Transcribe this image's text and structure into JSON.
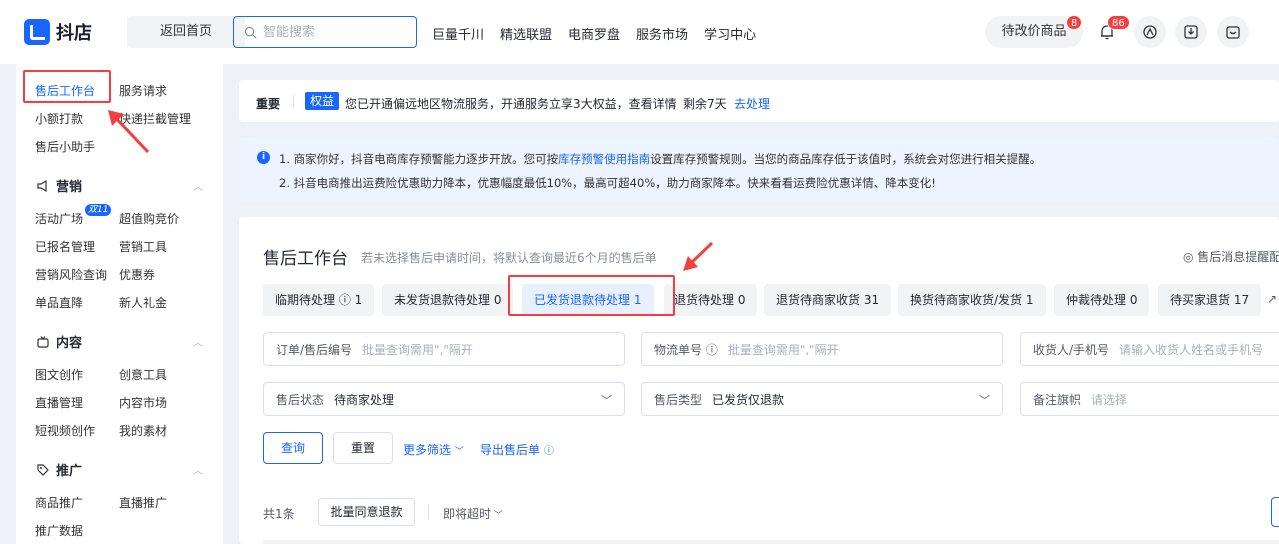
{
  "header": {
    "logo_text": "抖店",
    "home_label": "返回首页",
    "search_placeholder": "智能搜索",
    "nav": [
      "巨量千川",
      "精选联盟",
      "电商罗盘",
      "服务市场",
      "学习中心"
    ],
    "pending_label": "待改价商品",
    "pending_count": "8",
    "notify_count": "86"
  },
  "sidebar": {
    "top_items": [
      "售后工作台",
      "服务请求",
      "小额打款",
      "快递拦截管理",
      "售后小助手"
    ],
    "sections": [
      {
        "title": "营销",
        "items": [
          "活动广场",
          "超值购竞价",
          "已报名管理",
          "营销工具",
          "营销风险查询",
          "优惠券",
          "单品直降",
          "新人礼金"
        ],
        "tag": "双11"
      },
      {
        "title": "内容",
        "items": [
          "图文创作",
          "创意工具",
          "直播管理",
          "内容市场",
          "短视频创作",
          "我的素材"
        ]
      },
      {
        "title": "推广",
        "items": [
          "商品推广",
          "直播推广",
          "推广数据"
        ]
      }
    ]
  },
  "notice": {
    "label": "重要",
    "tag": "权益",
    "text": "您已开通偏远地区物流服务，开通服务立享3大权益，查看详情",
    "remain": "剩余7天",
    "action": "去处理"
  },
  "info": {
    "line1_pre": "1. 商家你好，抖音电商库存预警能力逐步开放。您可按",
    "line1_link": "库存预警使用指南",
    "line1_post": "设置库存预警规则。当您的商品库存低于该值时，系统会对您进行相关提醒。",
    "line2": "2. 抖音电商推出运费险优惠助力降本，优惠幅度最低10%，最高可超40%，助力商家降本。快来看看运费险优惠详情、降本变化!"
  },
  "workbench": {
    "title": "售后工作台",
    "subtitle": "若未选择售后申请时间，将默认查询最近6个月的售后单",
    "reminder": "售后消息提醒配",
    "tabs": [
      {
        "label": "临期待处理 ⓘ 1"
      },
      {
        "label": "未发货退款待处理 0"
      },
      {
        "label": "已发货退款待处理 1"
      },
      {
        "label": "退货待处理 0"
      },
      {
        "label": "退货待商家收货 31"
      },
      {
        "label": "换货待商家收货/发货 1"
      },
      {
        "label": "仲裁待处理 0"
      },
      {
        "label": "待买家退货 17"
      }
    ],
    "filters": {
      "order_label": "订单/售后编号",
      "order_ph": "批量查询需用\",\"隔开",
      "logistics_label": "物流单号 ⓘ",
      "logistics_ph": "批量查询需用\",\"隔开",
      "receiver_label": "收货人/手机号",
      "receiver_ph": "请输入收货人姓名或手机号",
      "status_label": "售后状态",
      "status_val": "待商家处理",
      "type_label": "售后类型",
      "type_val": "已发货仅退款",
      "flag_label": "备注旗帜",
      "flag_ph": "请选择"
    },
    "query": "查询",
    "reset": "重置",
    "more": "更多筛选",
    "export": "导出售后单",
    "total": "共1条",
    "batch": "批量同意退款",
    "timeout": "即将超时"
  },
  "colors": {
    "accent": "#1966ff",
    "highlight": "#f53f3f"
  }
}
